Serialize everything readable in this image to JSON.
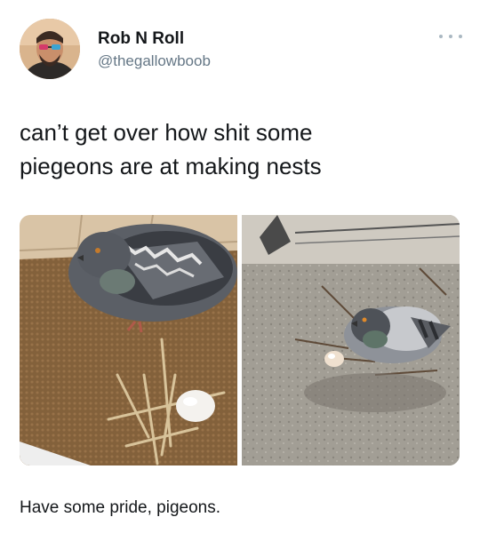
{
  "tweet": {
    "display_name": "Rob N Roll",
    "handle": "@thegallowboob",
    "text_line_1": "can’t get over how shit some",
    "text_line_2": "piegeons are at making nests"
  },
  "caption": "Have some pride, pigeons.",
  "icons": {
    "more": "more-options-icon"
  },
  "colors": {
    "name": "#14171a",
    "handle": "#657786",
    "more_dots": "#aab8c2"
  }
}
